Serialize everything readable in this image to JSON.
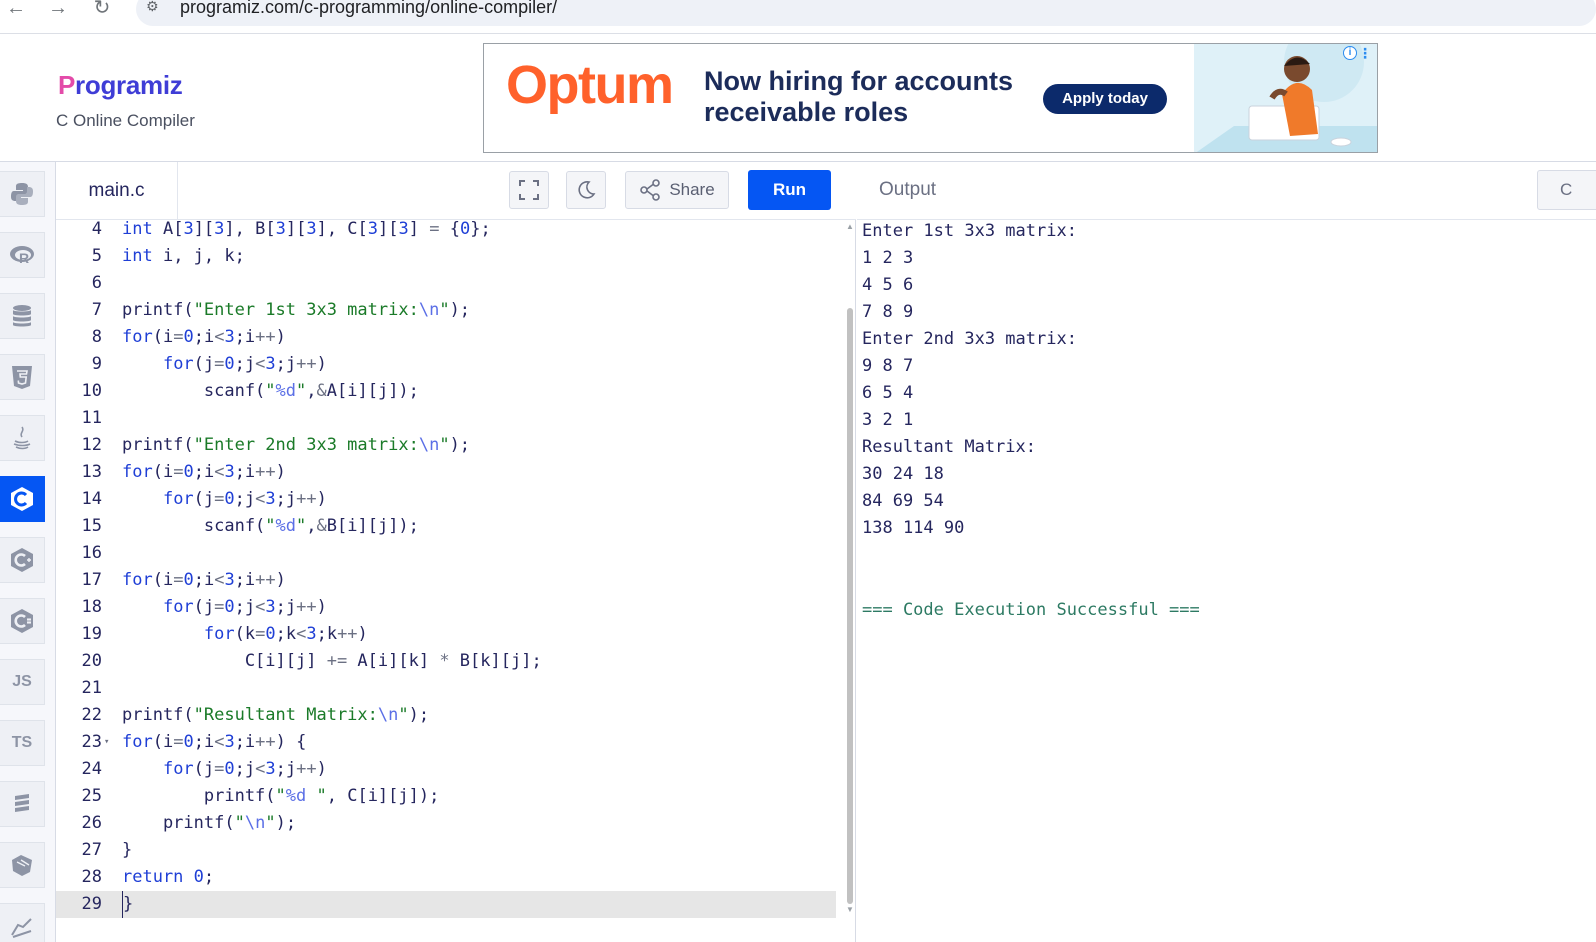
{
  "browser": {
    "url": "programiz.com/c-programming/online-compiler/",
    "back_glyph": "←",
    "forward_glyph": "→",
    "reload_glyph": "↻",
    "site_info_glyph": "⚙"
  },
  "header": {
    "logo_mark": "P",
    "logo_rest": "rogramiz",
    "subtitle": "C Online Compiler"
  },
  "ad": {
    "brand": "Optum",
    "headline": "Now hiring for accounts\nreceivable roles",
    "cta": "Apply today",
    "info_glyph": "i",
    "dots_glyph": "⋮"
  },
  "sidebar": {
    "items": [
      {
        "name": "python",
        "icon": "python-icon",
        "label": ""
      },
      {
        "name": "r",
        "icon": "r-icon",
        "label": ""
      },
      {
        "name": "sql",
        "icon": "database-icon",
        "label": ""
      },
      {
        "name": "html",
        "icon": "html5-icon",
        "label": ""
      },
      {
        "name": "java",
        "icon": "java-icon",
        "label": ""
      },
      {
        "name": "c",
        "icon": "c-icon",
        "label": "",
        "active": true
      },
      {
        "name": "cpp",
        "icon": "cpp-icon",
        "label": ""
      },
      {
        "name": "csharp",
        "icon": "csharp-icon",
        "label": ""
      },
      {
        "name": "js",
        "icon": "js-icon",
        "label": "JS"
      },
      {
        "name": "ts",
        "icon": "ts-icon",
        "label": "TS"
      },
      {
        "name": "go",
        "icon": "go-icon",
        "label": ""
      },
      {
        "name": "swift",
        "icon": "swift-icon",
        "label": ""
      },
      {
        "name": "rust",
        "icon": "rust-icon",
        "label": ""
      }
    ]
  },
  "editor": {
    "file_tab": "main.c",
    "share_label": "Share",
    "run_label": "Run",
    "lines": [
      {
        "n": "4",
        "html": "<span class=\"kw\">int</span> A[<span class=\"num\">3</span>][<span class=\"num\">3</span>], B[<span class=\"num\">3</span>][<span class=\"num\">3</span>], C[<span class=\"num\">3</span>][<span class=\"num\">3</span>] <span class=\"op\">=</span> {<span class=\"num\">0</span>};"
      },
      {
        "n": "5",
        "html": "<span class=\"kw\">int</span> i, j, k;"
      },
      {
        "n": "6",
        "html": ""
      },
      {
        "n": "7",
        "html": "printf(<span class=\"str\">\"Enter 1st 3x3 matrix:</span><span class=\"esc\">\\n</span><span class=\"str\">\"</span>);"
      },
      {
        "n": "8",
        "html": "<span class=\"kw\">for</span>(i<span class=\"op\">=</span><span class=\"num\">0</span>;i<span class=\"op\">&lt;</span><span class=\"num\">3</span>;i<span class=\"op\">++</span>)"
      },
      {
        "n": "9",
        "html": "    <span class=\"kw\">for</span>(j<span class=\"op\">=</span><span class=\"num\">0</span>;j<span class=\"op\">&lt;</span><span class=\"num\">3</span>;j<span class=\"op\">++</span>)"
      },
      {
        "n": "10",
        "html": "        scanf(<span class=\"str\">\"</span><span class=\"esc\">%d</span><span class=\"str\">\"</span>,<span class=\"op\">&amp;</span>A[i][j]);"
      },
      {
        "n": "11",
        "html": ""
      },
      {
        "n": "12",
        "html": "printf(<span class=\"str\">\"Enter 2nd 3x3 matrix:</span><span class=\"esc\">\\n</span><span class=\"str\">\"</span>);"
      },
      {
        "n": "13",
        "html": "<span class=\"kw\">for</span>(i<span class=\"op\">=</span><span class=\"num\">0</span>;i<span class=\"op\">&lt;</span><span class=\"num\">3</span>;i<span class=\"op\">++</span>)"
      },
      {
        "n": "14",
        "html": "    <span class=\"kw\">for</span>(j<span class=\"op\">=</span><span class=\"num\">0</span>;j<span class=\"op\">&lt;</span><span class=\"num\">3</span>;j<span class=\"op\">++</span>)"
      },
      {
        "n": "15",
        "html": "        scanf(<span class=\"str\">\"</span><span class=\"esc\">%d</span><span class=\"str\">\"</span>,<span class=\"op\">&amp;</span>B[i][j]);"
      },
      {
        "n": "16",
        "html": ""
      },
      {
        "n": "17",
        "html": "<span class=\"kw\">for</span>(i<span class=\"op\">=</span><span class=\"num\">0</span>;i<span class=\"op\">&lt;</span><span class=\"num\">3</span>;i<span class=\"op\">++</span>)"
      },
      {
        "n": "18",
        "html": "    <span class=\"kw\">for</span>(j<span class=\"op\">=</span><span class=\"num\">0</span>;j<span class=\"op\">&lt;</span><span class=\"num\">3</span>;j<span class=\"op\">++</span>)"
      },
      {
        "n": "19",
        "html": "        <span class=\"kw\">for</span>(k<span class=\"op\">=</span><span class=\"num\">0</span>;k<span class=\"op\">&lt;</span><span class=\"num\">3</span>;k<span class=\"op\">++</span>)"
      },
      {
        "n": "20",
        "html": "            C[i][j] <span class=\"op\">+=</span> A[i][k] <span class=\"op\">*</span> B[k][j];"
      },
      {
        "n": "21",
        "html": ""
      },
      {
        "n": "22",
        "html": "printf(<span class=\"str\">\"Resultant Matrix:</span><span class=\"esc\">\\n</span><span class=\"str\">\"</span>);"
      },
      {
        "n": "23",
        "html": "<span class=\"kw\">for</span>(i<span class=\"op\">=</span><span class=\"num\">0</span>;i<span class=\"op\">&lt;</span><span class=\"num\">3</span>;i<span class=\"op\">++</span>) {",
        "fold": true
      },
      {
        "n": "24",
        "html": "    <span class=\"kw\">for</span>(j<span class=\"op\">=</span><span class=\"num\">0</span>;j<span class=\"op\">&lt;</span><span class=\"num\">3</span>;j<span class=\"op\">++</span>)"
      },
      {
        "n": "25",
        "html": "        printf(<span class=\"str\">\"</span><span class=\"esc\">%d</span><span class=\"str\"> \"</span>, C[i][j]);"
      },
      {
        "n": "26",
        "html": "    printf(<span class=\"str\">\"</span><span class=\"esc\">\\n</span><span class=\"str\">\"</span>);"
      },
      {
        "n": "27",
        "html": "}"
      },
      {
        "n": "28",
        "html": "<span class=\"kw\">return</span> <span class=\"num\">0</span>;"
      },
      {
        "n": "29",
        "html": "}",
        "active": true,
        "outdent": true
      }
    ]
  },
  "output": {
    "title": "Output",
    "clear_label": "C",
    "lines": [
      "Enter 1st 3x3 matrix:",
      "1 2 3",
      "4 5 6",
      "7 8 9",
      "Enter 2nd 3x3 matrix:",
      "9 8 7",
      "6 5 4",
      "3 2 1",
      "Resultant Matrix:",
      "30 24 18",
      "84 69 54",
      "138 114 90"
    ],
    "status": "=== Code Execution Successful ==="
  }
}
